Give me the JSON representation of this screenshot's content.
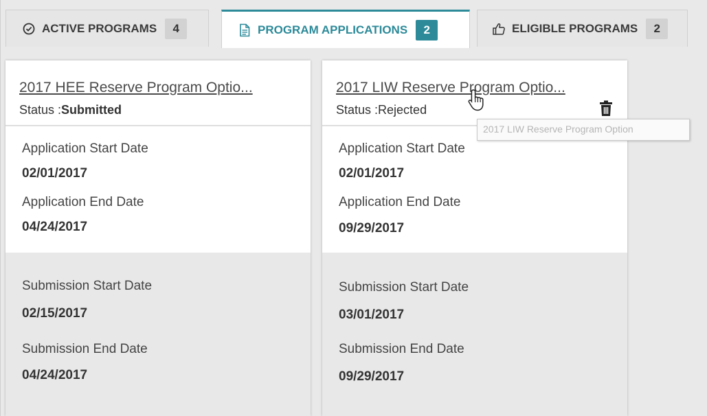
{
  "tabs": [
    {
      "label": "ACTIVE PROGRAMS",
      "count": "4",
      "icon": "check-circle-icon"
    },
    {
      "label": "PROGRAM APPLICATIONS",
      "count": "2",
      "icon": "document-icon"
    },
    {
      "label": "ELIGIBLE PROGRAMS",
      "count": "2",
      "icon": "thumbs-up-icon"
    }
  ],
  "colors": {
    "accent": "#2c8a99"
  },
  "cards": [
    {
      "title": "2017 HEE Reserve Program Optio...",
      "status_label": "Status :",
      "status": "Submitted",
      "app_start_label": "Application Start Date",
      "app_start": "02/01/2017",
      "app_end_label": "Application End Date",
      "app_end": "04/24/2017",
      "sub_start_label": "Submission Start Date",
      "sub_start": "02/15/2017",
      "sub_end_label": "Submission End Date",
      "sub_end": "04/24/2017"
    },
    {
      "title": "2017 LIW Reserve Program Optio...",
      "status_label": "Status :",
      "status": "Rejected",
      "app_start_label": "Application Start Date",
      "app_start": "02/01/2017",
      "app_end_label": "Application End Date",
      "app_end": "09/29/2017",
      "sub_start_label": "Submission Start Date",
      "sub_start": "03/01/2017",
      "sub_end_label": "Submission End Date",
      "sub_end": "09/29/2017"
    }
  ],
  "tooltip": "2017 LIW Reserve Program Option"
}
